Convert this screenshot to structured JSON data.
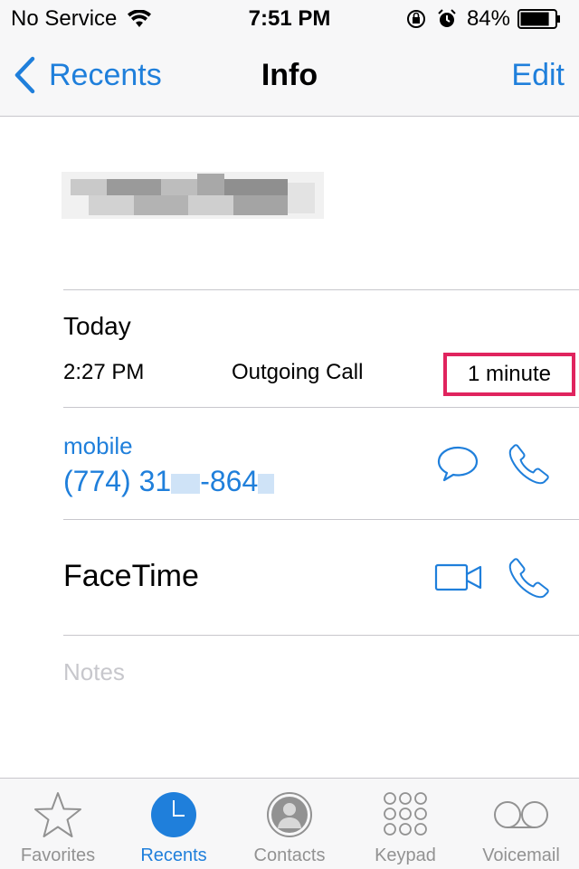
{
  "status_bar": {
    "carrier": "No Service",
    "time": "7:51 PM",
    "battery_percent": "84%",
    "battery_level": 0.84
  },
  "nav": {
    "back_label": "Recents",
    "title": "Info",
    "edit_label": "Edit"
  },
  "recent_call": {
    "day": "Today",
    "time": "2:27 PM",
    "type": "Outgoing Call",
    "duration": "1 minute"
  },
  "phone": {
    "label": "mobile",
    "number_part1": "(774) 31",
    "number_part2": "-864"
  },
  "facetime": {
    "label": "FaceTime"
  },
  "notes": {
    "placeholder": "Notes"
  },
  "tabs": [
    {
      "label": "Favorites",
      "icon": "star-icon",
      "active": false
    },
    {
      "label": "Recents",
      "icon": "clock-icon",
      "active": true
    },
    {
      "label": "Contacts",
      "icon": "person-icon",
      "active": false
    },
    {
      "label": "Keypad",
      "icon": "keypad-icon",
      "active": false
    },
    {
      "label": "Voicemail",
      "icon": "voicemail-icon",
      "active": false
    }
  ],
  "colors": {
    "accent": "#1f7fdb",
    "highlight_box": "#e0245e",
    "inactive": "#929292",
    "separator": "#c8c7cc"
  }
}
